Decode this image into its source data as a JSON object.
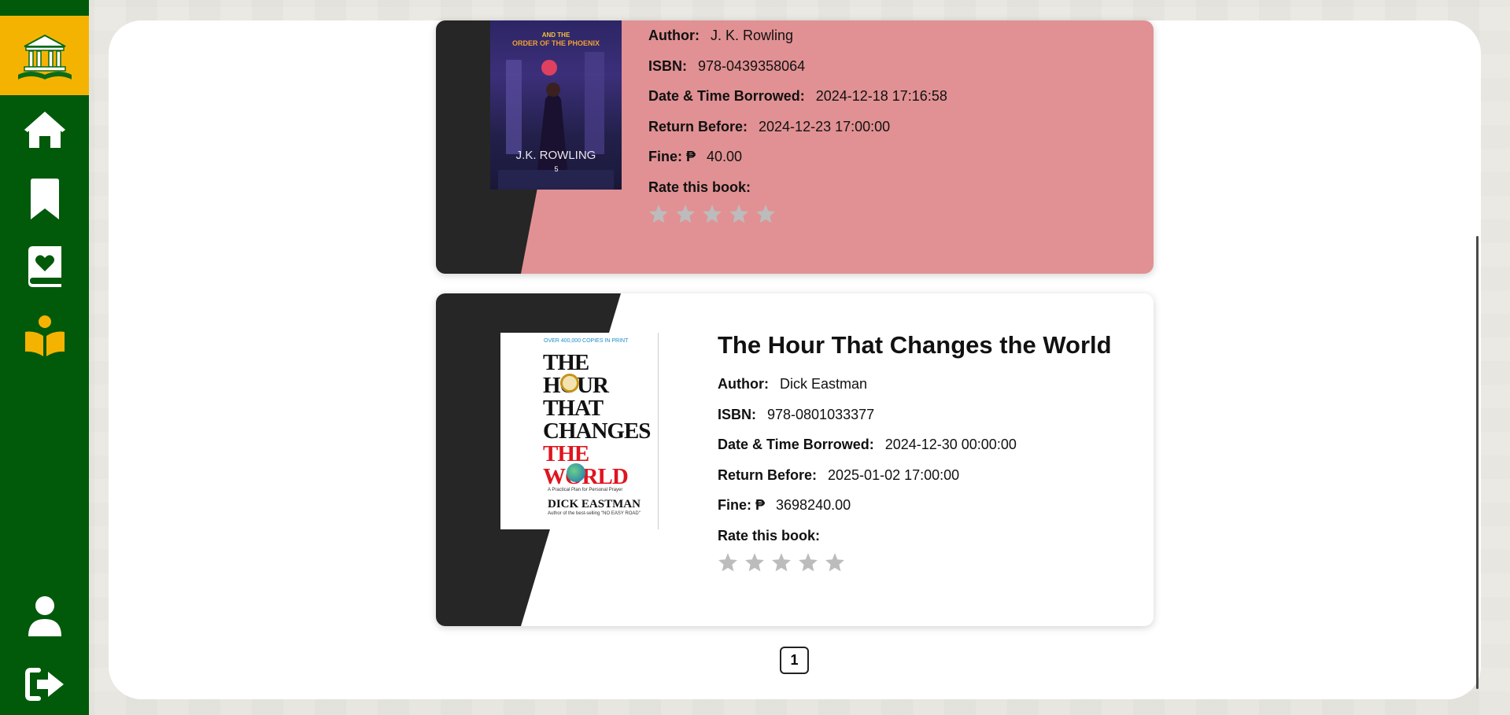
{
  "sidebar": {
    "logo": "library-logo-icon",
    "nav": [
      {
        "icon": "home-icon"
      },
      {
        "icon": "bookmark-icon"
      },
      {
        "icon": "favorite-book-icon"
      },
      {
        "icon": "reading-icon"
      }
    ],
    "bottom": [
      {
        "icon": "user-icon"
      },
      {
        "icon": "logout-icon"
      }
    ],
    "accent": "#f5b301",
    "background": "#005a0a"
  },
  "labels": {
    "author": "Author:",
    "isbn": "ISBN:",
    "borrowed": "Date & Time Borrowed:",
    "return_before": "Return Before:",
    "fine": "Fine: ₱",
    "rate": "Rate this book:"
  },
  "books": [
    {
      "author": "J. K. Rowling",
      "isbn": "978-0439358064",
      "borrowed": "2024-12-18 17:16:58",
      "return_before": "2024-12-23 17:00:00",
      "fine": "40.00",
      "rating": 0,
      "status_color": "#e19193",
      "cover": {
        "subtitle": "ORDER OF THE PHOENIX",
        "and_the": "AND THE",
        "author": "J.K. ROWLING",
        "number": "5"
      }
    },
    {
      "title": "The Hour That Changes the World",
      "author": "Dick Eastman",
      "isbn": "978-0801033377",
      "borrowed": "2024-12-30 00:00:00",
      "return_before": "2025-01-02 17:00:00",
      "fine": "3698240.00",
      "rating": 0,
      "status_color": "#ffffff",
      "cover": {
        "banner": "OVER 400,000 COPIES IN PRINT",
        "line1": "THE",
        "line2": "HOUR",
        "line3": "THAT",
        "line4": "CHANGES",
        "line5": "THE",
        "line6": "WORLD",
        "tagline": "A Practical Plan for Personal Prayer",
        "author": "DICK EASTMAN",
        "author_note": "Author of the best-selling \"NO EASY ROAD\""
      }
    }
  ],
  "pagination": {
    "current": "1"
  }
}
